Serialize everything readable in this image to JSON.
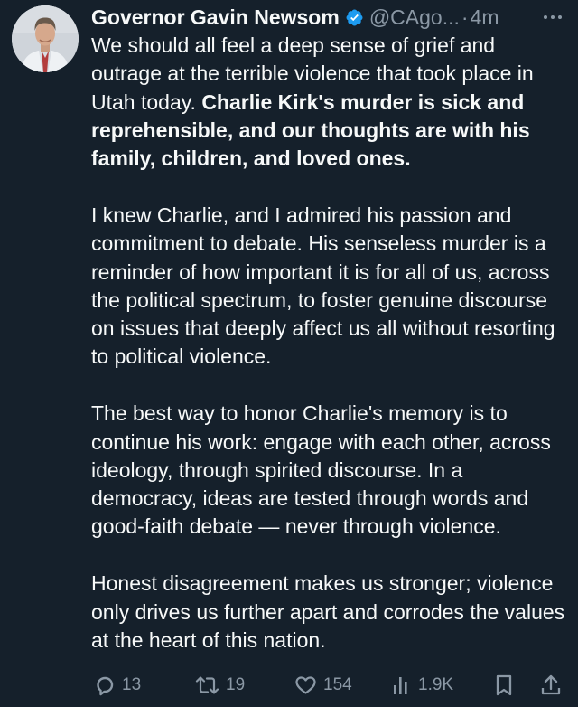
{
  "author": {
    "display_name": "Governor Gavin Newsom",
    "handle": "@CAgo...",
    "separator": "·",
    "timestamp": "4m",
    "verified_icon": "verified-badge-icon",
    "avatar_icon": "avatar-photo"
  },
  "tweet": {
    "p1_text": "We should all feel a deep sense of grief and outrage at the terrible violence that took place in Utah today.",
    "p1_bold": "Charlie Kirk's murder is sick and reprehensible, and our thoughts are with his family, children, and loved ones.",
    "p2": "I knew Charlie, and I admired his passion and commitment to debate. His senseless murder is a reminder of how important it is for all of us, across the political spectrum, to foster genuine discourse on issues that deeply affect us all without resorting to political violence.",
    "p3": "The best way to honor Charlie's memory is to continue his work: engage with each other, across ideology, through spirited discourse. In a democracy, ideas are tested through words and good-faith debate — never through violence.",
    "p4": "Honest disagreement makes us stronger; violence only drives us further apart and corrodes the values at the heart of this nation."
  },
  "actions": {
    "replies": "13",
    "reposts": "19",
    "likes": "154",
    "views": "1.9K",
    "icons": [
      "reply-icon",
      "repost-icon",
      "like-icon",
      "views-icon",
      "bookmark-icon",
      "share-icon"
    ]
  },
  "colors": {
    "background": "#15202b",
    "text": "#f7f9f9",
    "muted": "#8b98a5",
    "verified": "#1d9bf0"
  }
}
